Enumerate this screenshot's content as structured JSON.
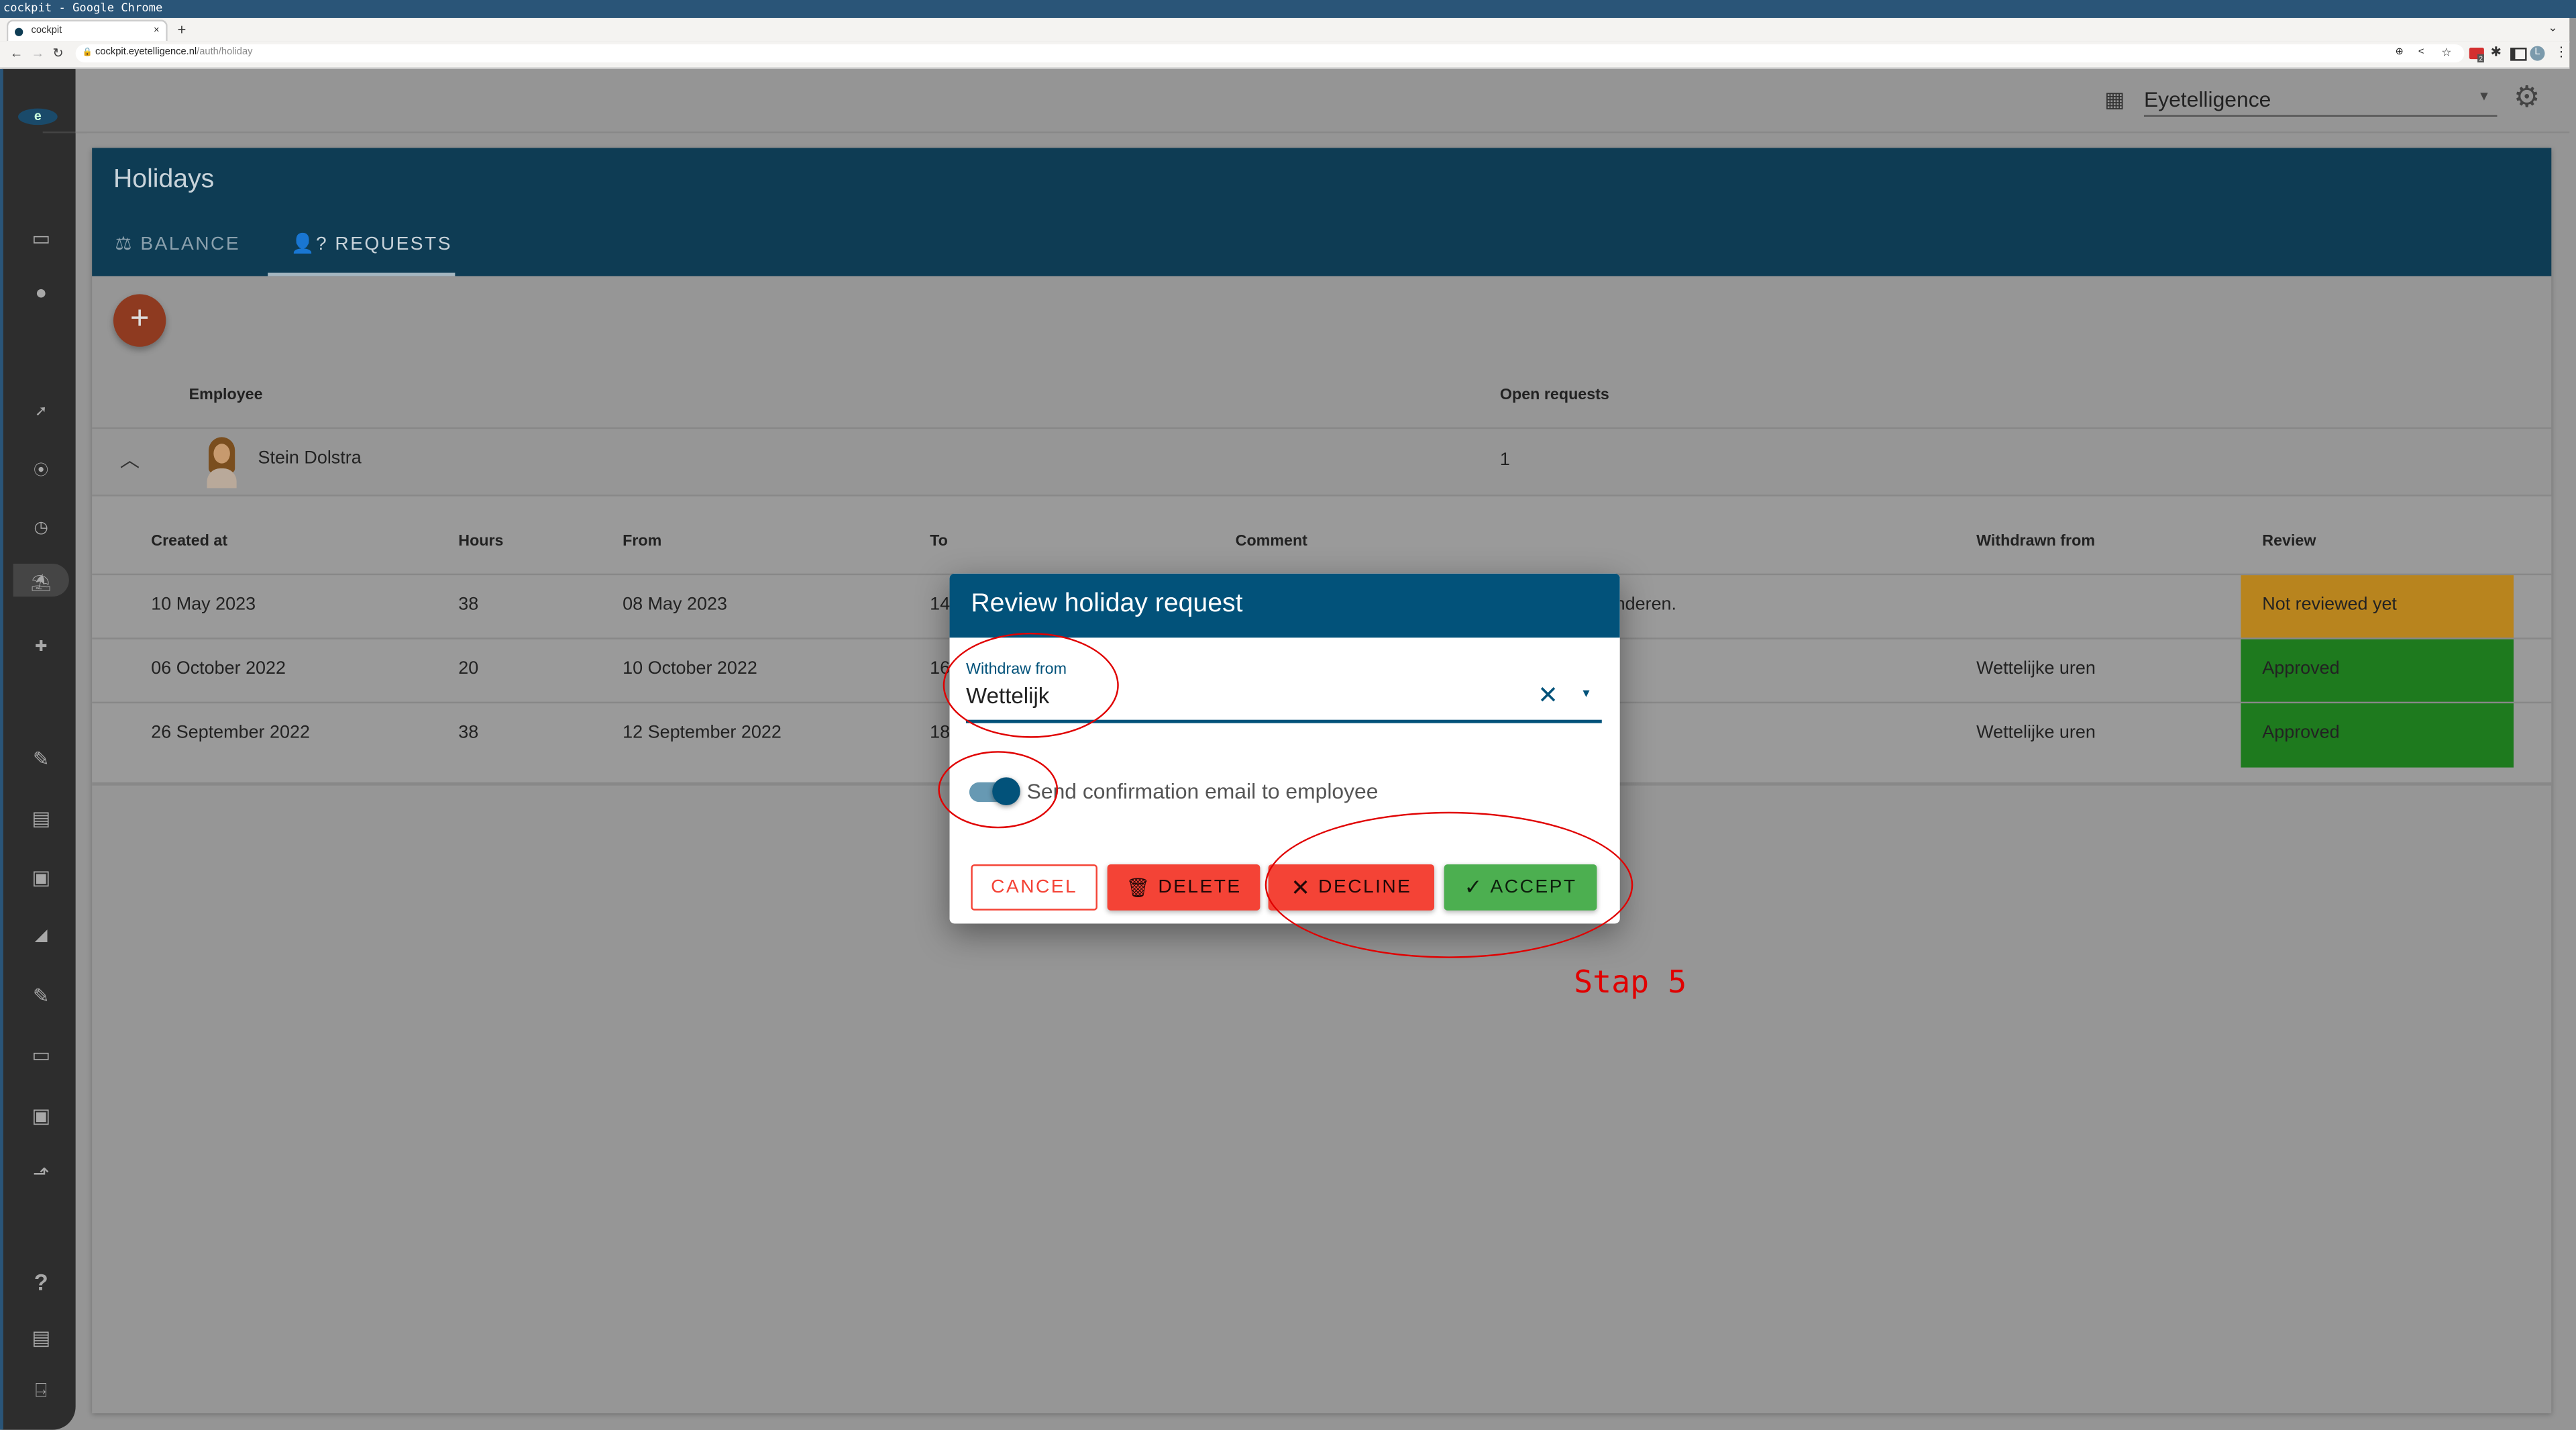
{
  "browser": {
    "window_title": "cockpit - Google Chrome",
    "tab_title": "cockpit",
    "url_host": "cockpit.eyetelligence.nl",
    "url_path": "/auth/holiday",
    "extension_badge": "2",
    "profile_initial": "L"
  },
  "sidebar": {
    "icons": [
      "logo-icon",
      "calendar-icon",
      "person-icon",
      "sick-icon",
      "time-clock-icon",
      "clock-icon",
      "holiday-icon",
      "medical-kit-icon",
      "document-edit-icon",
      "cash-register-icon",
      "contact-card-icon",
      "camera-icon",
      "form-edit-icon",
      "monitor-icon",
      "money-icon",
      "stairs-icon",
      "help-icon",
      "book-icon",
      "exit-icon"
    ],
    "logo_letter": "e"
  },
  "topbar": {
    "company": "Eyetelligence"
  },
  "page": {
    "title": "Holidays",
    "tabs": [
      {
        "label": "BALANCE",
        "active": false
      },
      {
        "label": "REQUESTS",
        "active": true
      }
    ],
    "columns": {
      "employee": "Employee",
      "open_requests": "Open requests"
    },
    "employee_row": {
      "name": "Stein Dolstra",
      "open_requests": "1"
    },
    "requests": {
      "columns": [
        "Created at",
        "Hours",
        "From",
        "To",
        "Comment",
        "Withdrawn from",
        "Review"
      ],
      "rows": [
        {
          "created": "10 May 2023",
          "hours": "38",
          "from": "08 May 2023",
          "to": "14",
          "comment": "e kinderen.",
          "withdrawn": "",
          "review": "Not reviewed yet",
          "review_color": "#b8841e"
        },
        {
          "created": "06 October 2022",
          "hours": "20",
          "from": "10 October 2022",
          "to": "16",
          "comment": "",
          "withdrawn": "Wettelijke uren",
          "review": "Approved",
          "review_color": "#1e7a1e"
        },
        {
          "created": "26 September 2022",
          "hours": "38",
          "from": "12 September 2022",
          "to": "18",
          "comment": "",
          "withdrawn": "Wettelijke uren",
          "review": "Approved",
          "review_color": "#1e7a1e"
        }
      ]
    }
  },
  "dialog": {
    "title": "Review holiday request",
    "field_label": "Withdraw from",
    "field_value": "Wettelijk",
    "toggle_label": "Send confirmation email to employee",
    "toggle_on": true,
    "buttons": {
      "cancel": "CANCEL",
      "delete": "DELETE",
      "decline": "DECLINE",
      "accept": "ACCEPT"
    }
  },
  "annotation": {
    "step": "Stap 5"
  },
  "colors": {
    "header": "#0e3c54",
    "dialog_header": "#02527a",
    "danger": "#f44336",
    "success": "#4caf50",
    "annotation": "#e00000"
  }
}
